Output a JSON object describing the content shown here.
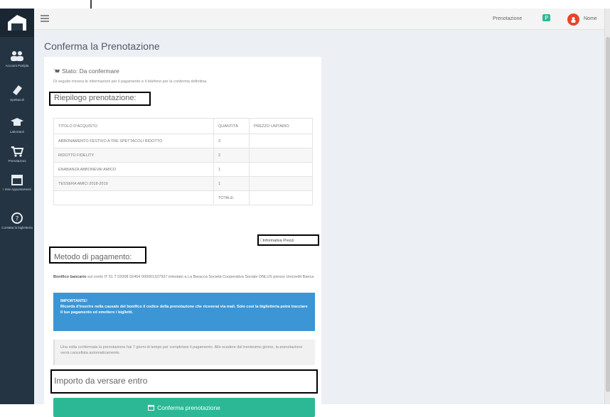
{
  "header": {
    "reservation_label": "Prenotazione",
    "user_name": "Nome"
  },
  "sidebar": {
    "items": [
      {
        "label": "Account Partipla",
        "icon": "users-icon"
      },
      {
        "label": "Spettacoli",
        "icon": "ticket-icon"
      },
      {
        "label": "Laboratori",
        "icon": "graduation-cap-icon"
      },
      {
        "label": "Prenotazioni",
        "icon": "cart-icon"
      },
      {
        "label": "I miei Appuntamenti",
        "icon": "calendar-icon"
      },
      {
        "label": "Contatta la biglietteria",
        "icon": "help-circle-icon"
      }
    ]
  },
  "page": {
    "title": "Conferma la Prenotazione",
    "status": "Stato: Da confermare",
    "status_note": "Di seguito trovera le informazioni per il pagamento e il telefono per la conferma definitiva."
  },
  "summary": {
    "title": "Riepilogo prenotazione:",
    "columns": [
      "TITOLO D'ACQUISTO",
      "QUANTITÀ",
      "PREZZO UNITARIO"
    ],
    "rows": [
      [
        "ABBONAMENTO FESTIVO A TRE SPETTACOLI RIDOTTO",
        "3",
        ""
      ],
      [
        "RIDOTTO FIDELITY",
        "2",
        ""
      ],
      [
        "ENABANZA ABBONEVAI AMICO",
        "1",
        ""
      ],
      [
        "TESSERA AMICI 2018-2019",
        "1",
        ""
      ]
    ],
    "total_label": "TOTALE:",
    "info_button": "Informativa Prezzi"
  },
  "payment": {
    "title": "Metodo di pagamento:",
    "bonifico_label": "Bonifico bancario",
    "bonifico_text": "sul conto IT 51 T 02008 02464 000001327937 intestato a La Baracca Società Cooperativa Sociale ONLUS presso Unicredit Banca",
    "important_title": "IMPORTANTE!",
    "important_text": "Ricorda d'inserire nella causale del bonifico il codice della prenotazione che riceverai via mail. Solo così la biglietteria potrà tracciare il tuo pagamento ed emettere i biglietti.",
    "notice_text": "Una volta confermata la prenotazione hai 7 giorni di tempo per completare il pagamento. Allo scadere del trentesimo giorno, la prenotazione verrà cancellata automaticamente."
  },
  "amount": {
    "title": "Importo da versare entro"
  },
  "actions": {
    "confirm_label": "Conferma prenotazione"
  }
}
